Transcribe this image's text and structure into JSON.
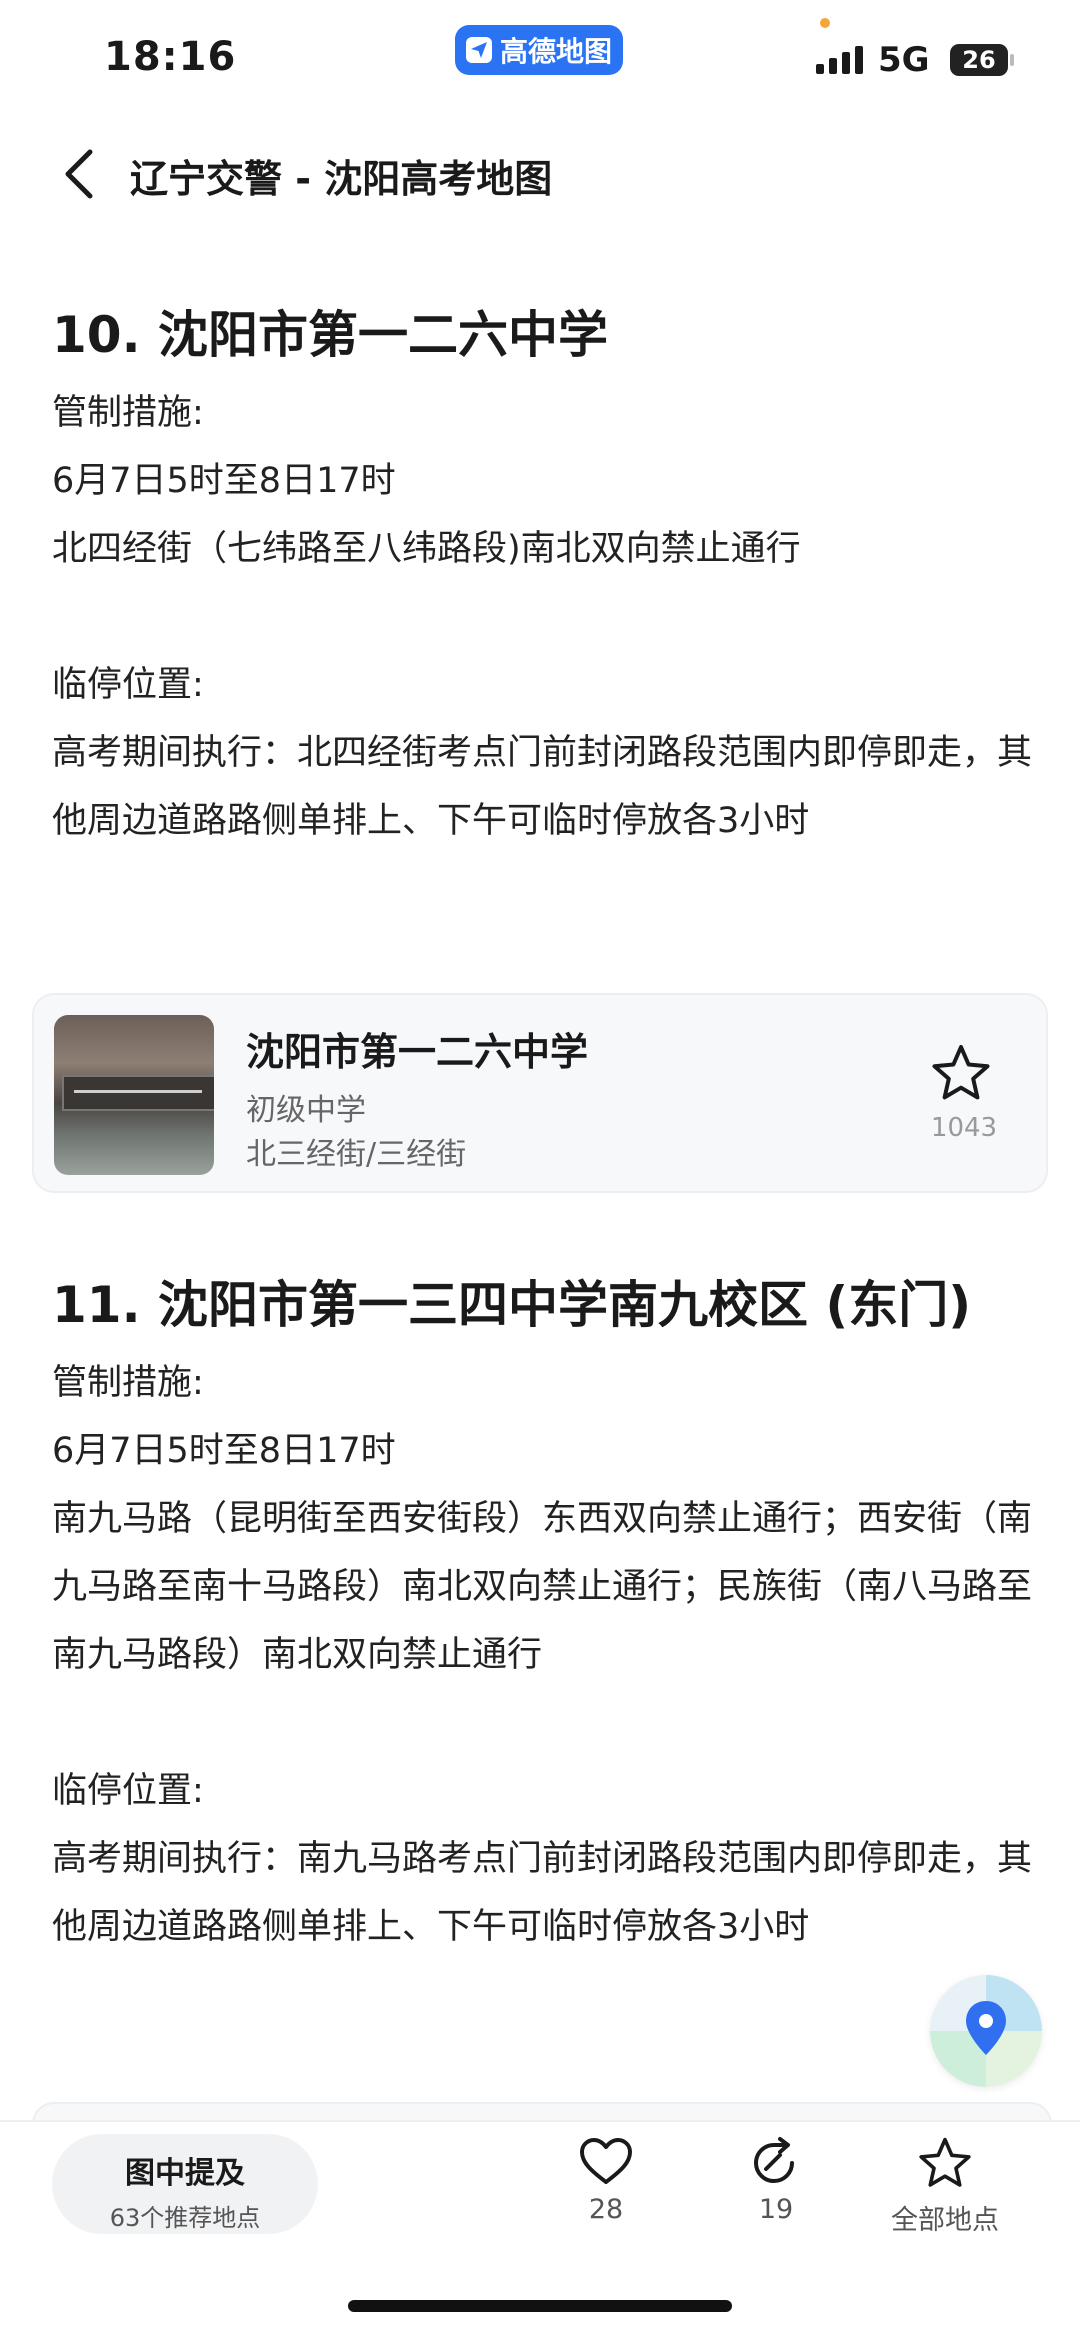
{
  "status": {
    "time": "18:16",
    "app_badge": "高德地图",
    "network": "5G",
    "battery": "26"
  },
  "nav": {
    "title": "辽宁交警 - 沈阳高考地图"
  },
  "sections": [
    {
      "heading": "10. 沈阳市第一二六中学",
      "control_label": "管制措施:",
      "control_time": "6月7日5时至8日17时",
      "control_text": "北四经街（七纬路至八纬路段)南北双向禁止通行",
      "parking_label": "临停位置:",
      "parking_text": "高考期间执行：北四经街考点门前封闭路段范围内即停即走，其他周边道路路侧单排上、下午可临时停放各3小时"
    },
    {
      "heading": "11. 沈阳市第一三四中学南九校区 (东门)",
      "control_label": "管制措施:",
      "control_time": "6月7日5时至8日17时",
      "control_text": "南九马路（昆明街至西安街段）东西双向禁止通行；西安街（南九马路至南十马路段）南北双向禁止通行；民族街（南八马路至南九马路段）南北双向禁止通行",
      "parking_label": "临停位置:",
      "parking_text": "高考期间执行：南九马路考点门前封闭路段范围内即停即走，其他周边道路路侧单排上、下午可临时停放各3小时"
    }
  ],
  "place_card": {
    "name": "沈阳市第一二六中学",
    "category": "初级中学",
    "address": "北三经街/三经街",
    "favorites": "1043",
    "icon": "star-icon"
  },
  "bottom_bar": {
    "recommend_title": "图中提及",
    "recommend_sub": "63个推荐地点",
    "likes": "28",
    "shares": "19",
    "all_places": "全部地点"
  },
  "colors": {
    "accent": "#2a74f4",
    "text": "#1a1a1a",
    "muted": "#999999"
  }
}
